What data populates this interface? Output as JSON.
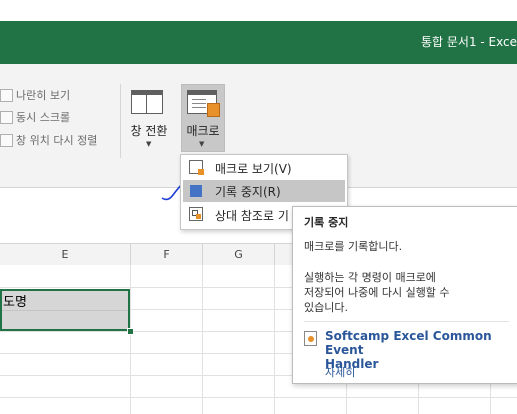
{
  "title_bar": {
    "title": "통합 문서1 - Exce",
    "color": "#217346"
  },
  "ribbon": {
    "side_by_side": "나란히 보기",
    "sync_scroll": "동시 스크롤",
    "reset_position": "창 위치 다시 정렬",
    "switch_windows": "창 전환",
    "macros": "매크로"
  },
  "menu": {
    "items": [
      {
        "label": "매크로 보기(V)",
        "icon": "view-macros-icon"
      },
      {
        "label": "기록 중지(R)",
        "icon": "stop-square-icon"
      },
      {
        "label": "상대 참조로 기",
        "icon": "relative-reference-icon"
      }
    ]
  },
  "grid": {
    "columns": [
      "E",
      "F",
      "G"
    ],
    "selected_cell_text": "도명"
  },
  "tooltip": {
    "title": "기록 중지",
    "description": "매크로를 기록합니다.",
    "details": [
      "실행하는 각 명령이 매크로에",
      "저장되어 나중에 다시 실행할 수",
      "있습니다."
    ],
    "addin": [
      "Softcamp Excel Common Event",
      "Handler"
    ],
    "more": "자세히"
  },
  "colors": {
    "accent": "#217346",
    "link": "#2b579a",
    "menu_highlight": "#c6c6c6"
  }
}
